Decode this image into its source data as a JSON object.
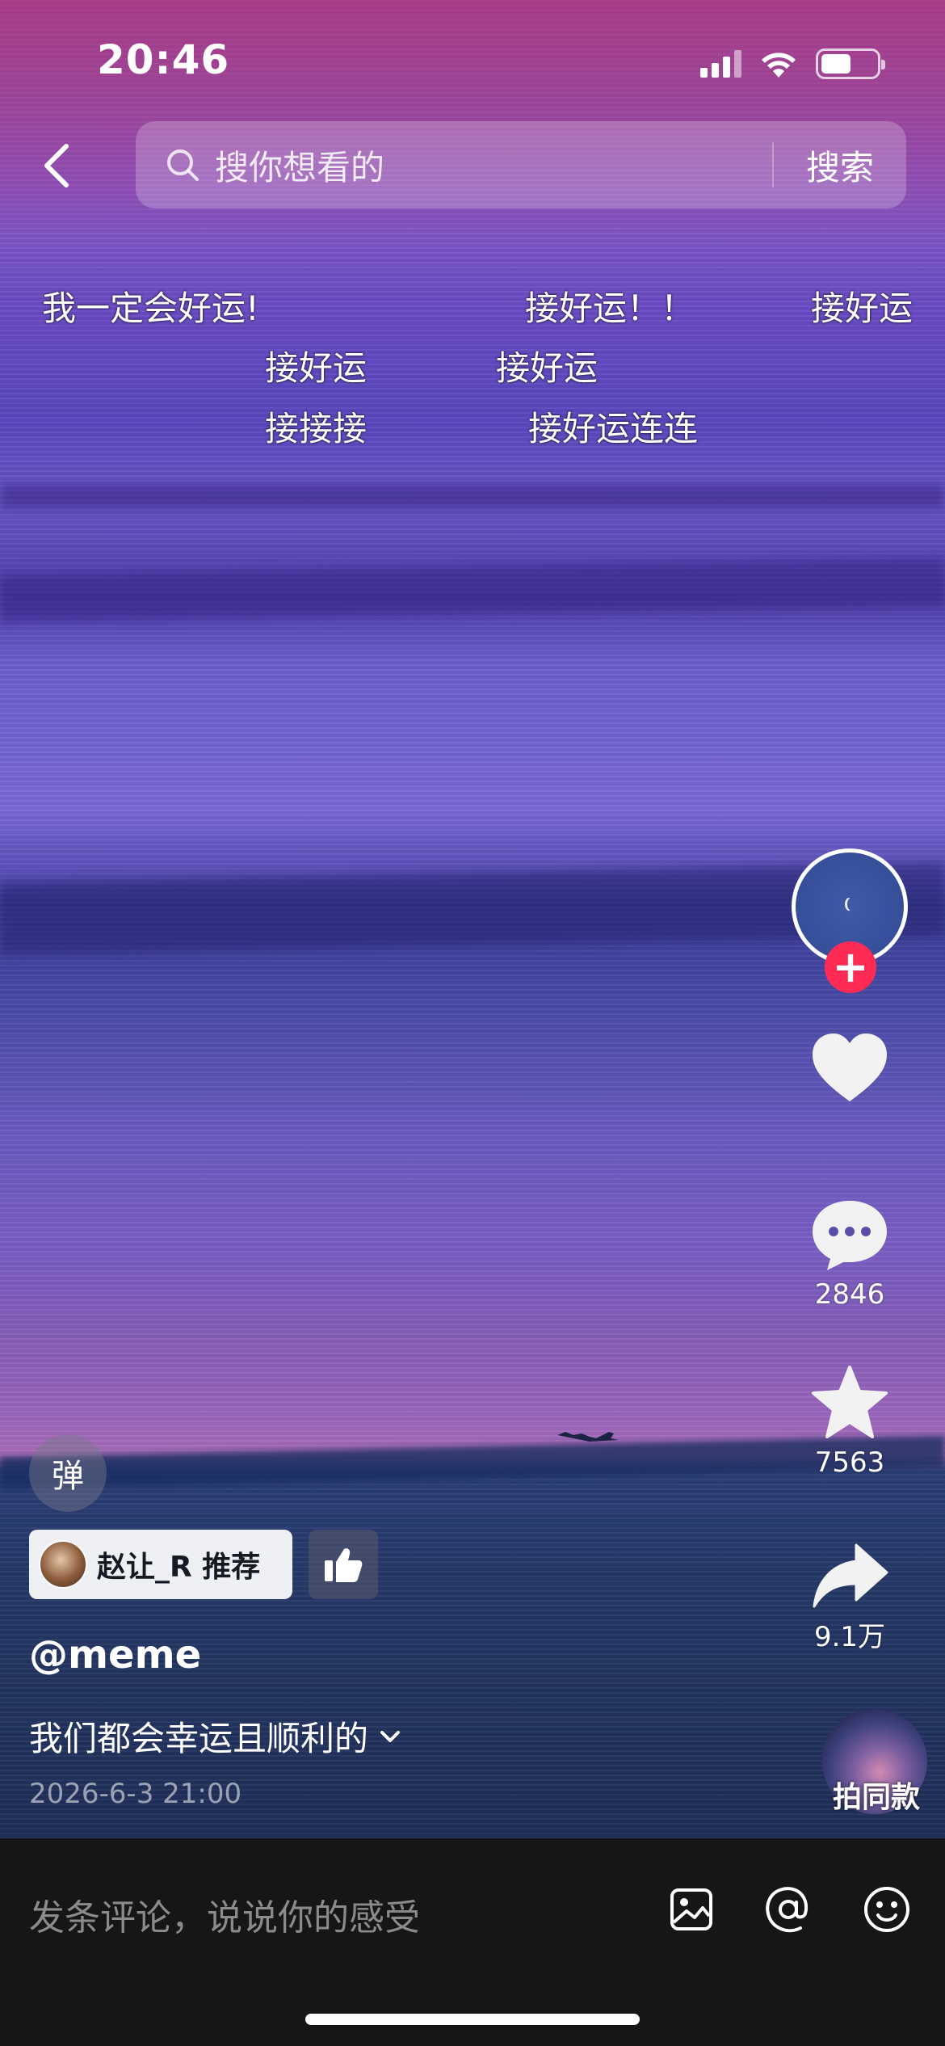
{
  "status_bar": {
    "time": "20:46"
  },
  "search": {
    "placeholder": "搜你想看的",
    "submit_label": "搜索"
  },
  "danmaku": [
    {
      "text": "我一定会好运!"
    },
    {
      "text": "接好运！！"
    },
    {
      "text": "接好运"
    },
    {
      "text": "接好运"
    },
    {
      "text": "接好运"
    },
    {
      "text": "接接接"
    },
    {
      "text": "接好运连连"
    }
  ],
  "rail": {
    "like_count": "",
    "comment_count": "2846",
    "favorite_count": "7563",
    "share_count": "9.1万",
    "music_label": "拍同款"
  },
  "danmaku_toggle_label": "弹",
  "recommend": {
    "user": "赵让_R",
    "label": "推荐"
  },
  "author": "@meme",
  "caption": "我们都会幸运且顺利的",
  "date": "2026-6-3 21:00",
  "comment_bar": {
    "placeholder": "发条评论，说说你的感受"
  },
  "colors": {
    "follow_red": "#fe2c55",
    "comment_bar_bg": "#161616"
  }
}
